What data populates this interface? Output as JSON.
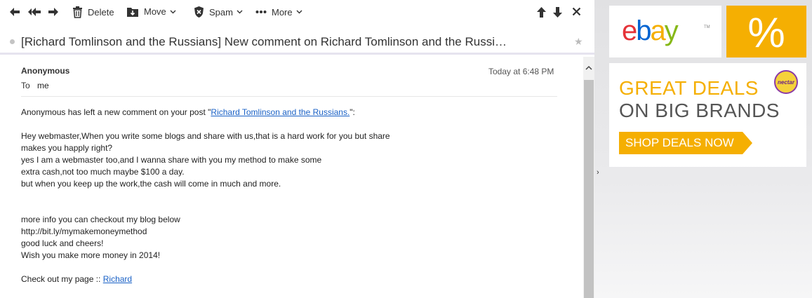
{
  "toolbar": {
    "delete_label": "Delete",
    "move_label": "Move",
    "spam_label": "Spam",
    "more_label": "More"
  },
  "subject": "[Richard Tomlinson and the Russians] New comment on Richard Tomlinson and the Russi…",
  "message": {
    "sender": "Anonymous",
    "time": "Today at 6:48 PM",
    "to_label": "To",
    "to_value": "me",
    "intro_prefix": "Anonymous has left a new comment on your post \"",
    "intro_link": "Richard Tomlinson and the Russians.",
    "intro_suffix": "\":",
    "lines_a": [
      "Hey webmaster,When you write some blogs and share with us,that is a hard work for you but share",
      "makes you happly right?",
      "yes I am a webmaster too,and I wanna share with you my method to make some",
      "extra cash,not too much maybe $100 a day.",
      "but when you keep up the work,the cash will come in much and more."
    ],
    "lines_b": [
      "more info you can checkout my blog below",
      "http://bit.ly/mymakemoneymethod",
      "good luck and cheers!",
      "Wish you make more money in 2014!"
    ],
    "footer_prefix": "Check out my page :: ",
    "footer_link": "Richard"
  },
  "ads": {
    "ebay_letters": [
      "e",
      "b",
      "a",
      "y"
    ],
    "ebay_tm": "TM",
    "percent": "%",
    "deal_line1": "GREAT DEALS",
    "deal_line2": "ON BIG BRANDS",
    "nectar": "nectar",
    "shop_label": "SHOP DEALS NOW"
  },
  "colors": {
    "link": "#1a61c6",
    "ebay_e": "#e53238",
    "ebay_b": "#0064d2",
    "ebay_a": "#f5af02",
    "ebay_y": "#86b817",
    "deal_accent": "#f5af02"
  }
}
